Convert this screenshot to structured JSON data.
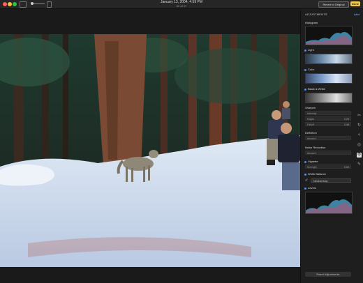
{
  "window": {
    "title": "January 13, 2004, 4:59 PM",
    "subtitle": "22 of 37",
    "revert_label": "Revert to Original",
    "done_label": "Done"
  },
  "panel": {
    "title": "ADJUSTMENTS",
    "add_label": "Add",
    "histogram_label": "Histogram",
    "light_label": "Light",
    "color_label": "Color",
    "bw_label": "Black & White",
    "sharpen_label": "Sharpen",
    "sharpen_intensity": "Intensity",
    "sharpen_edges": "Edges",
    "sharpen_edges_val": "0.25",
    "sharpen_falloff": "Falloff",
    "sharpen_falloff_val": "0.48",
    "definition_label": "Definition",
    "definition_amount": "Amount",
    "noise_label": "Noise Reduction",
    "noise_amount": "Amount",
    "vignette_label": "Vignette",
    "vignette_strength": "Strength",
    "vignette_strength_val": "0.00",
    "wb_label": "White Balance",
    "wb_value": "Neutral Gray",
    "levels_label": "Levels",
    "reset_label": "Reset Adjustments"
  },
  "colors": {
    "accent": "#4a90e2",
    "done_button": "#f2c94c"
  }
}
